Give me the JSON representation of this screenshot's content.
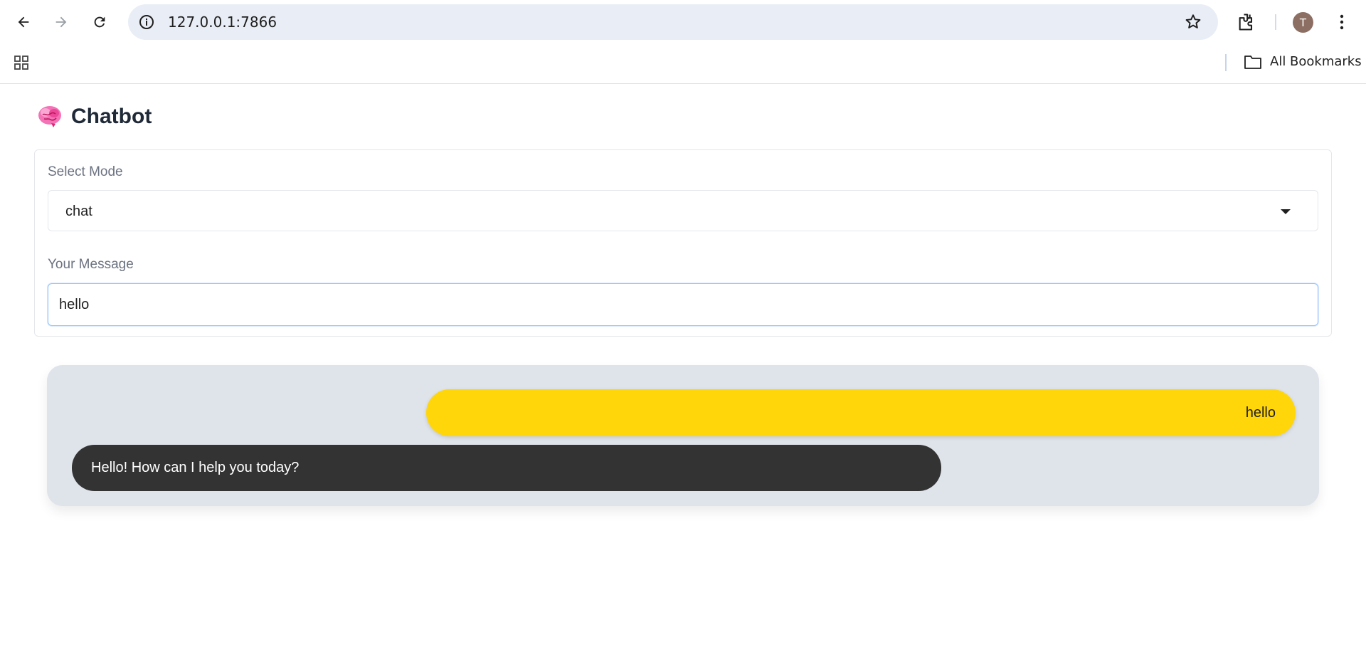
{
  "browser": {
    "url": "127.0.0.1:7866",
    "avatar_letter": "T",
    "all_bookmarks_label": "All Bookmarks"
  },
  "app": {
    "title": "Chatbot",
    "title_icon": "brain-icon",
    "mode_label": "Select Mode",
    "mode_value": "chat",
    "message_label": "Your Message",
    "message_value": "hello"
  },
  "chat": {
    "messages": [
      {
        "role": "user",
        "text": "hello"
      },
      {
        "role": "bot",
        "text": "Hello! How can I help you today?"
      }
    ]
  },
  "colors": {
    "user_bubble": "#ffd60a",
    "bot_bubble": "#333333",
    "chat_background": "#dfe3ea"
  }
}
